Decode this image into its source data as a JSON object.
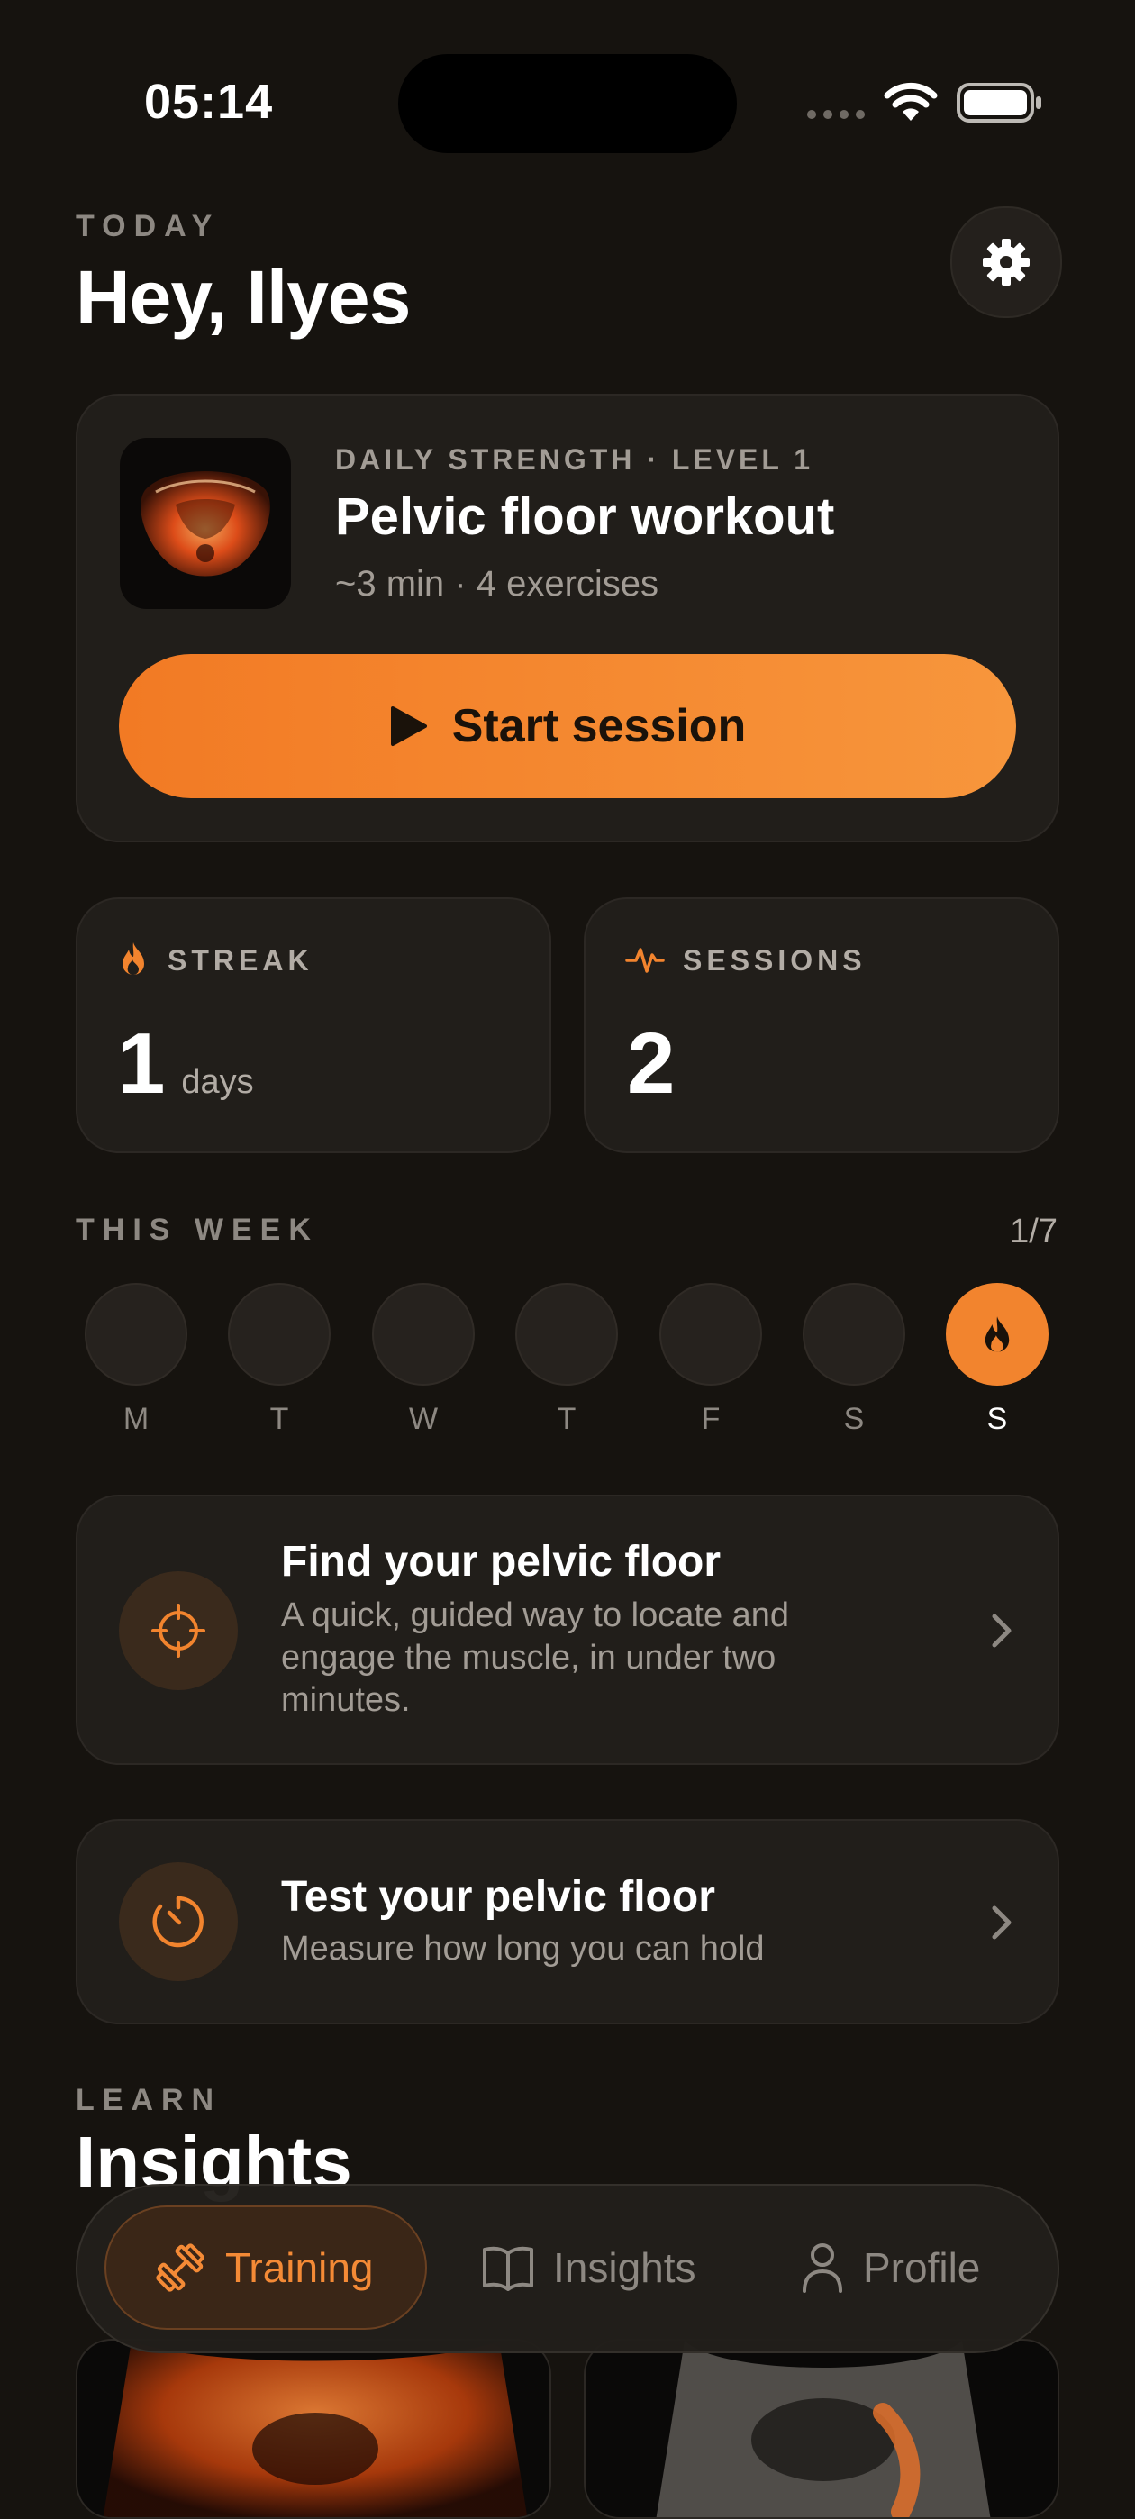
{
  "status_bar": {
    "time": "05:14"
  },
  "header": {
    "eyebrow": "TODAY",
    "greeting": "Hey, Ilyes",
    "settings_icon": "gear-icon"
  },
  "hero": {
    "eyebrow": "DAILY STRENGTH · LEVEL 1",
    "title": "Pelvic floor workout",
    "meta": "~3 min · 4 exercises",
    "start_label": "Start session",
    "accent": "#f27a24"
  },
  "stats": {
    "streak": {
      "label": "STREAK",
      "value": "1",
      "unit": "days",
      "icon": "flame-icon"
    },
    "sessions": {
      "label": "SESSIONS",
      "value": "2",
      "icon": "pulse-icon"
    }
  },
  "week": {
    "label": "THIS WEEK",
    "count": "1/7",
    "days": [
      "M",
      "T",
      "W",
      "T",
      "F",
      "S",
      "S"
    ],
    "active_index": 6
  },
  "features": [
    {
      "title": "Find your pelvic floor",
      "subtitle_lines": [
        "A quick, guided way to locate and",
        "engage the muscle, in under two",
        "minutes."
      ],
      "icon": "crosshair-icon"
    },
    {
      "title": "Test your pelvic floor",
      "subtitle": "Measure how long you can hold",
      "icon": "timer-icon"
    }
  ],
  "learn": {
    "eyebrow": "LEARN",
    "title": "Insights"
  },
  "tabbar": {
    "tabs": [
      {
        "label": "Training",
        "icon": "dumbbell-icon",
        "active": true
      },
      {
        "label": "Insights",
        "icon": "book-icon",
        "active": false
      },
      {
        "label": "Profile",
        "icon": "person-icon",
        "active": false
      }
    ]
  }
}
